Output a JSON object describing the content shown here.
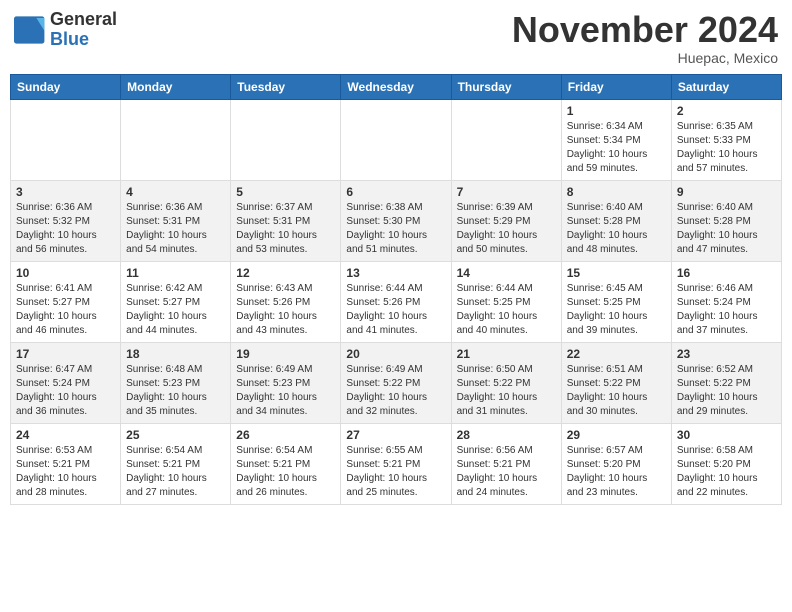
{
  "header": {
    "logo_line1": "General",
    "logo_line2": "Blue",
    "month": "November 2024",
    "location": "Huepac, Mexico"
  },
  "days_of_week": [
    "Sunday",
    "Monday",
    "Tuesday",
    "Wednesday",
    "Thursday",
    "Friday",
    "Saturday"
  ],
  "weeks": [
    [
      {
        "day": "",
        "info": ""
      },
      {
        "day": "",
        "info": ""
      },
      {
        "day": "",
        "info": ""
      },
      {
        "day": "",
        "info": ""
      },
      {
        "day": "",
        "info": ""
      },
      {
        "day": "1",
        "info": "Sunrise: 6:34 AM\nSunset: 5:34 PM\nDaylight: 10 hours and 59 minutes."
      },
      {
        "day": "2",
        "info": "Sunrise: 6:35 AM\nSunset: 5:33 PM\nDaylight: 10 hours and 57 minutes."
      }
    ],
    [
      {
        "day": "3",
        "info": "Sunrise: 6:36 AM\nSunset: 5:32 PM\nDaylight: 10 hours and 56 minutes."
      },
      {
        "day": "4",
        "info": "Sunrise: 6:36 AM\nSunset: 5:31 PM\nDaylight: 10 hours and 54 minutes."
      },
      {
        "day": "5",
        "info": "Sunrise: 6:37 AM\nSunset: 5:31 PM\nDaylight: 10 hours and 53 minutes."
      },
      {
        "day": "6",
        "info": "Sunrise: 6:38 AM\nSunset: 5:30 PM\nDaylight: 10 hours and 51 minutes."
      },
      {
        "day": "7",
        "info": "Sunrise: 6:39 AM\nSunset: 5:29 PM\nDaylight: 10 hours and 50 minutes."
      },
      {
        "day": "8",
        "info": "Sunrise: 6:40 AM\nSunset: 5:28 PM\nDaylight: 10 hours and 48 minutes."
      },
      {
        "day": "9",
        "info": "Sunrise: 6:40 AM\nSunset: 5:28 PM\nDaylight: 10 hours and 47 minutes."
      }
    ],
    [
      {
        "day": "10",
        "info": "Sunrise: 6:41 AM\nSunset: 5:27 PM\nDaylight: 10 hours and 46 minutes."
      },
      {
        "day": "11",
        "info": "Sunrise: 6:42 AM\nSunset: 5:27 PM\nDaylight: 10 hours and 44 minutes."
      },
      {
        "day": "12",
        "info": "Sunrise: 6:43 AM\nSunset: 5:26 PM\nDaylight: 10 hours and 43 minutes."
      },
      {
        "day": "13",
        "info": "Sunrise: 6:44 AM\nSunset: 5:26 PM\nDaylight: 10 hours and 41 minutes."
      },
      {
        "day": "14",
        "info": "Sunrise: 6:44 AM\nSunset: 5:25 PM\nDaylight: 10 hours and 40 minutes."
      },
      {
        "day": "15",
        "info": "Sunrise: 6:45 AM\nSunset: 5:25 PM\nDaylight: 10 hours and 39 minutes."
      },
      {
        "day": "16",
        "info": "Sunrise: 6:46 AM\nSunset: 5:24 PM\nDaylight: 10 hours and 37 minutes."
      }
    ],
    [
      {
        "day": "17",
        "info": "Sunrise: 6:47 AM\nSunset: 5:24 PM\nDaylight: 10 hours and 36 minutes."
      },
      {
        "day": "18",
        "info": "Sunrise: 6:48 AM\nSunset: 5:23 PM\nDaylight: 10 hours and 35 minutes."
      },
      {
        "day": "19",
        "info": "Sunrise: 6:49 AM\nSunset: 5:23 PM\nDaylight: 10 hours and 34 minutes."
      },
      {
        "day": "20",
        "info": "Sunrise: 6:49 AM\nSunset: 5:22 PM\nDaylight: 10 hours and 32 minutes."
      },
      {
        "day": "21",
        "info": "Sunrise: 6:50 AM\nSunset: 5:22 PM\nDaylight: 10 hours and 31 minutes."
      },
      {
        "day": "22",
        "info": "Sunrise: 6:51 AM\nSunset: 5:22 PM\nDaylight: 10 hours and 30 minutes."
      },
      {
        "day": "23",
        "info": "Sunrise: 6:52 AM\nSunset: 5:22 PM\nDaylight: 10 hours and 29 minutes."
      }
    ],
    [
      {
        "day": "24",
        "info": "Sunrise: 6:53 AM\nSunset: 5:21 PM\nDaylight: 10 hours and 28 minutes."
      },
      {
        "day": "25",
        "info": "Sunrise: 6:54 AM\nSunset: 5:21 PM\nDaylight: 10 hours and 27 minutes."
      },
      {
        "day": "26",
        "info": "Sunrise: 6:54 AM\nSunset: 5:21 PM\nDaylight: 10 hours and 26 minutes."
      },
      {
        "day": "27",
        "info": "Sunrise: 6:55 AM\nSunset: 5:21 PM\nDaylight: 10 hours and 25 minutes."
      },
      {
        "day": "28",
        "info": "Sunrise: 6:56 AM\nSunset: 5:21 PM\nDaylight: 10 hours and 24 minutes."
      },
      {
        "day": "29",
        "info": "Sunrise: 6:57 AM\nSunset: 5:20 PM\nDaylight: 10 hours and 23 minutes."
      },
      {
        "day": "30",
        "info": "Sunrise: 6:58 AM\nSunset: 5:20 PM\nDaylight: 10 hours and 22 minutes."
      }
    ]
  ]
}
